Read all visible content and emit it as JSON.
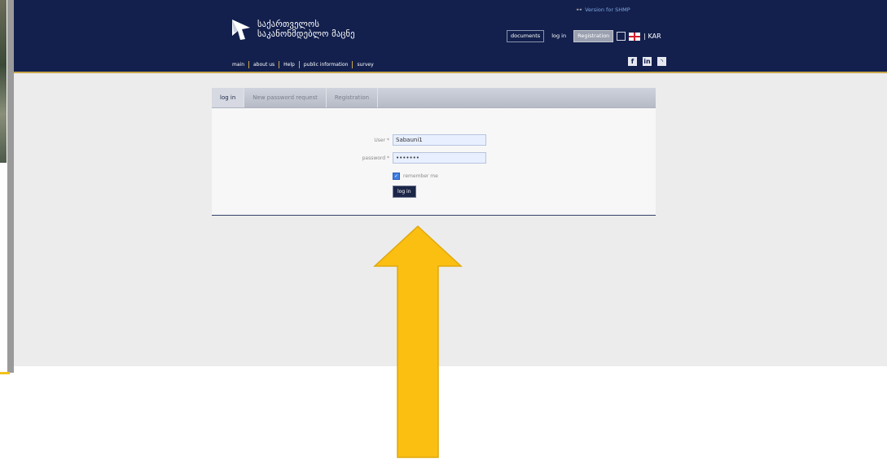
{
  "header": {
    "logo_line1": "საქართველოს",
    "logo_line2": "საკანონმდებლო მაცნე",
    "version_link": "Version for SHMP",
    "documents_label": "documents",
    "login_label": "log in",
    "registration_label": "Registration",
    "lang_label": "| KAR"
  },
  "nav": {
    "items": [
      "main",
      "about us",
      "Help",
      "public information",
      "survey"
    ]
  },
  "social": [
    "facebook-icon",
    "linkedin-icon",
    "rss-icon"
  ],
  "tabs": [
    "log in",
    "New password request",
    "Registration"
  ],
  "form": {
    "user_label": "User *",
    "user_value": "Sabauni1",
    "password_label": "password *",
    "password_value": "•••••••",
    "remember_label": "remember me",
    "remember_checked": true,
    "submit_label": "log in"
  },
  "colors": {
    "header_bg": "#13204d",
    "accent_gold": "#c7a64a",
    "arrow_fill": "#fbbf12"
  }
}
